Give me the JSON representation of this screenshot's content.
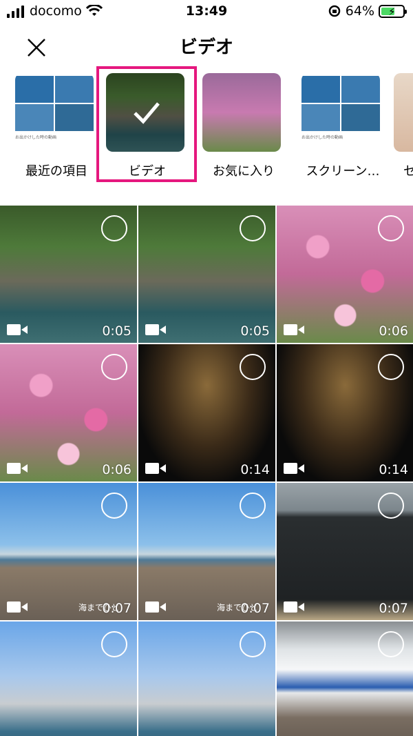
{
  "status_bar": {
    "carrier": "docomo",
    "time": "13:49",
    "battery": "64%",
    "battery_level": 0.64
  },
  "header": {
    "title": "ビデオ",
    "close_icon": "close-icon"
  },
  "albums": [
    {
      "label": "最近の項目",
      "selected": false
    },
    {
      "label": "ビデオ",
      "selected": true
    },
    {
      "label": "お気に入り",
      "selected": false
    },
    {
      "label": "スクリーン…",
      "selected": false
    },
    {
      "label": "セ",
      "selected": false
    }
  ],
  "album_thumb_caption": "お出かけした時の動画",
  "grid": [
    {
      "scene": "waterfall",
      "duration": "0:05",
      "caption": ""
    },
    {
      "scene": "waterfall",
      "duration": "0:05",
      "caption": ""
    },
    {
      "scene": "cosmos",
      "duration": "0:06",
      "caption": ""
    },
    {
      "scene": "cosmos",
      "duration": "0:06",
      "caption": ""
    },
    {
      "scene": "fireworks",
      "duration": "0:14",
      "caption": ""
    },
    {
      "scene": "fireworks",
      "duration": "0:14",
      "caption": ""
    },
    {
      "scene": "beach",
      "duration": "0:07",
      "caption": "海までひと"
    },
    {
      "scene": "beach",
      "duration": "0:07",
      "caption": "海までひと"
    },
    {
      "scene": "speaker",
      "duration": "0:07",
      "caption": ""
    },
    {
      "scene": "city",
      "duration": "",
      "caption": ""
    },
    {
      "scene": "city",
      "duration": "",
      "caption": ""
    },
    {
      "scene": "train",
      "duration": "",
      "caption": ""
    }
  ],
  "colors": {
    "selection_frame": "#e5177e",
    "battery_fill": "#4cd964"
  }
}
